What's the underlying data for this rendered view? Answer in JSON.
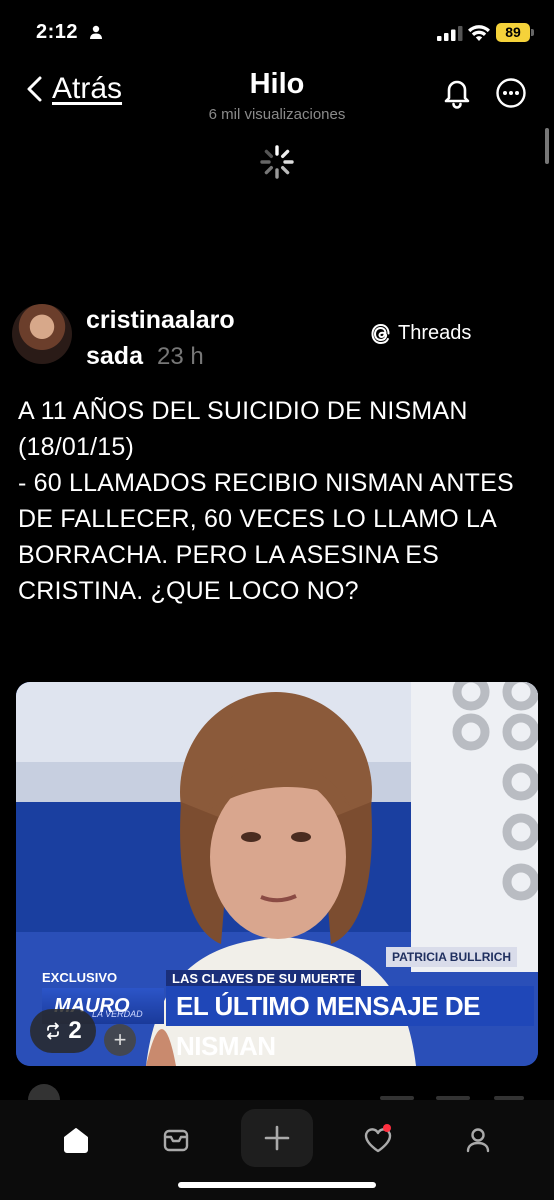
{
  "status_bar": {
    "time": "2:12",
    "battery": "89"
  },
  "nav": {
    "back_label": "Atrás",
    "title": "Hilo",
    "subtitle": "6 mil visualizaciones"
  },
  "post": {
    "username_line1": "cristinaalaro",
    "username_line2": "sada",
    "time_ago": "23 h",
    "source_badge": "Threads",
    "text": "A 11 AÑOS DEL SUICIDIO DE NISMAN (18/01/15)\n- 60 LLAMADOS RECIBIO NISMAN ANTES DE FALLECER, 60 VECES LO LLAMO LA BORRACHA. PERO LA ASESINA ES CRISTINA. ¿QUE LOCO NO?",
    "media": {
      "tag": "EXCLUSIVO",
      "name_chyron": "PATRICIA BULLRICH",
      "kicker": "LAS CLAVES DE SU MUERTE",
      "headline": "EL ÚLTIMO MENSAJE DE NISMAN",
      "show_logo": "MAURO",
      "show_sub": "LA VERDAD"
    },
    "repost_count": "2",
    "add_symbol": "+"
  },
  "icons": {
    "back": "chevron-left-icon",
    "bell": "bell-icon",
    "more": "more-circle-icon",
    "spinner": "loading-spinner-icon",
    "repost": "repost-icon",
    "threads": "threads-logo-icon",
    "tabs": [
      "home-icon",
      "inbox-icon",
      "plus-icon",
      "heart-icon",
      "profile-icon"
    ]
  },
  "colors": {
    "background": "#000000",
    "muted_text": "#8a8a8a",
    "battery": "#f5d23a",
    "notification_dot": "#ff3040"
  }
}
